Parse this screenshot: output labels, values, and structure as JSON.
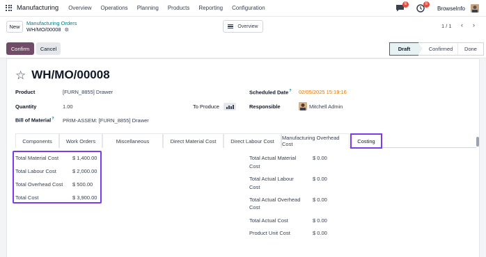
{
  "navbar": {
    "app_name": "Manufacturing",
    "menu": [
      "Overview",
      "Operations",
      "Planning",
      "Products",
      "Reporting",
      "Configuration"
    ],
    "messages_badge": "6",
    "activities_badge": "6",
    "company": "BrowseInfo"
  },
  "control": {
    "new_label": "New",
    "breadcrumb_parent": "Manufacturing Orders",
    "breadcrumb_current": "WH/MO/00008",
    "overview_label": "Overview",
    "pager": "1 / 1",
    "confirm_label": "Confirm",
    "cancel_label": "Cancel",
    "stages": [
      "Draft",
      "Confirmed",
      "Done"
    ],
    "active_stage": "Draft"
  },
  "form": {
    "title": "WH/MO/00008",
    "product_label": "Product",
    "product_value": "[FURN_8855] Drawer",
    "quantity_label": "Quantity",
    "quantity_value": "1.00",
    "to_produce_label": "To Produce",
    "bom_label": "Bill of Material",
    "bom_help": "?",
    "bom_value": "PRIM-ASSEM: [FURN_8855] Drawer",
    "scheduled_label": "Scheduled Date",
    "scheduled_help": "?",
    "scheduled_value": "02/05/2025 15:19:16",
    "responsible_label": "Responsible",
    "responsible_value": "Mitchell Admin"
  },
  "tabs": [
    "Components",
    "Work Orders",
    "Miscellaneous",
    "Direct Material Cost",
    "Direct Labour Cost",
    "Manufacturing Overhead Cost",
    "Costing"
  ],
  "active_tab": "Costing",
  "costing": {
    "planned": [
      {
        "label": "Total Material Cost",
        "value": "$ 1,400.00"
      },
      {
        "label": "Total Labour Cost",
        "value": "$ 2,000.00"
      },
      {
        "label": "Total Overhead Cost",
        "value": "$ 500.00"
      },
      {
        "label": "Total Cost",
        "value": "$ 3,900.00"
      }
    ],
    "actual": [
      {
        "label_line1": "Total Actual Material",
        "label_line2": "Cost",
        "value": "$ 0.00"
      },
      {
        "label_line1": "Total Actual Labour",
        "label_line2": "Cost",
        "value": "$ 0.00"
      },
      {
        "label_line1": "Total Actual Overhead",
        "label_line2": "Cost",
        "value": "$ 0.00"
      },
      {
        "label_line1": "Total Actual Cost",
        "label_line2": "",
        "value": "$ 0.00"
      },
      {
        "label_line1": "Product Unit Cost",
        "label_line2": "",
        "value": "$ 0.00"
      }
    ]
  },
  "colors": {
    "brand": "#714b67",
    "link": "#017e84",
    "highlight": "#7c3aed",
    "warning": "#d97706",
    "badge": "#e74c3c"
  }
}
